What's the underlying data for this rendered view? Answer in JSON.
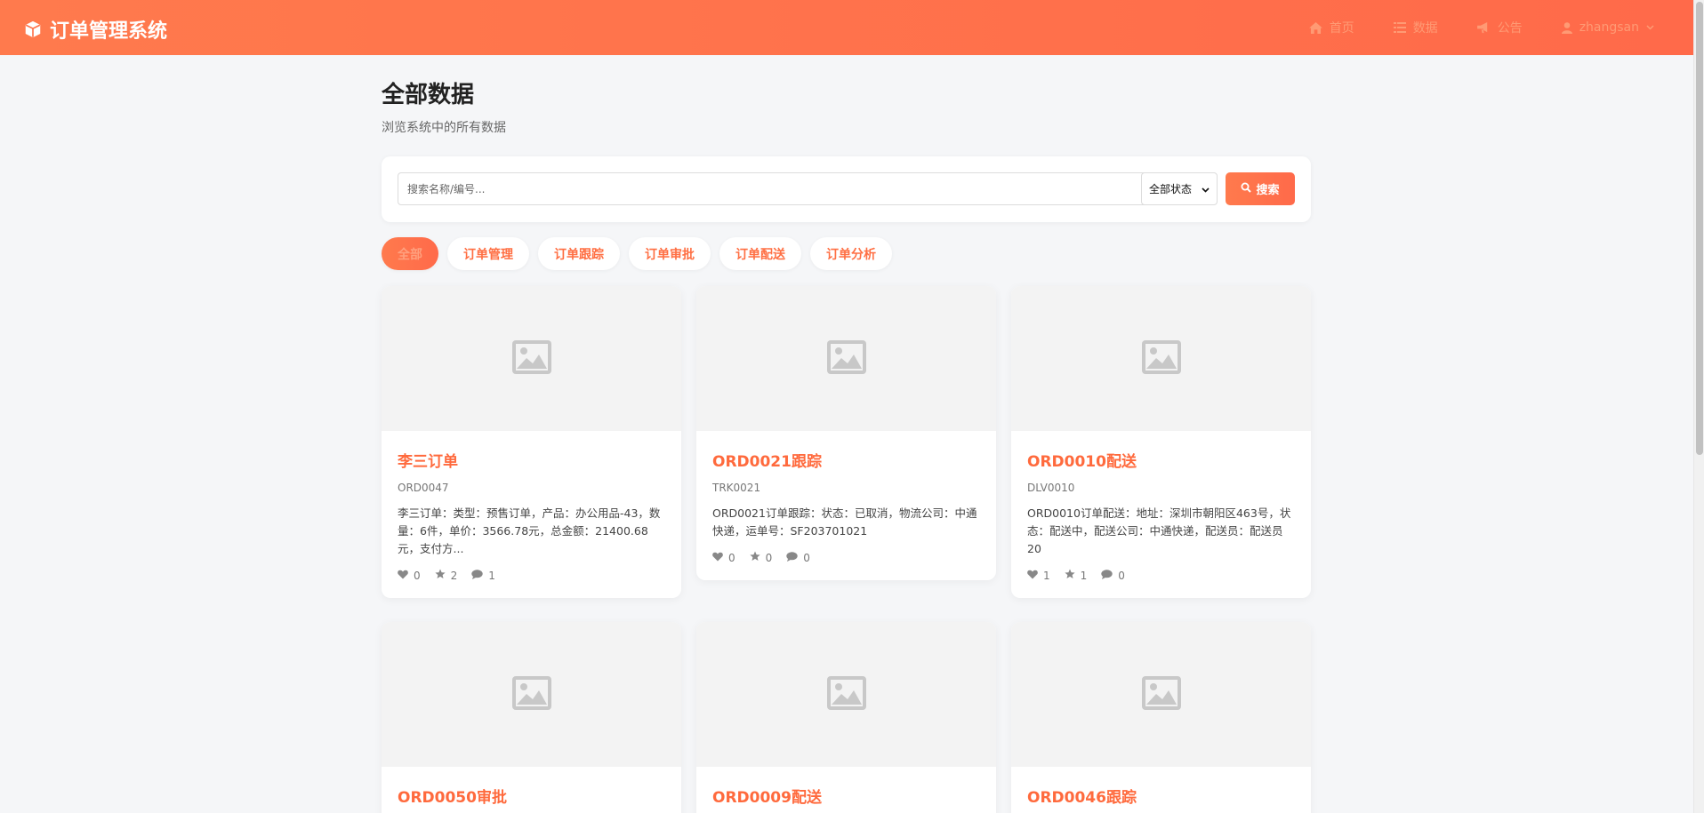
{
  "brand": {
    "title": "订单管理系统",
    "icon": "cube-icon"
  },
  "nav": {
    "items": [
      {
        "label": "首页",
        "icon": "home-icon"
      },
      {
        "label": "数据",
        "icon": "list-icon"
      },
      {
        "label": "公告",
        "icon": "bullhorn-icon"
      },
      {
        "label": "zhangsan",
        "icon": "user-icon"
      }
    ]
  },
  "page": {
    "title": "全部数据",
    "subtitle": "浏览系统中的所有数据"
  },
  "search": {
    "placeholder": "搜索名称/编号...",
    "status_selected": "全部状态",
    "button_label": "搜索"
  },
  "tabs": [
    "全部",
    "订单管理",
    "订单跟踪",
    "订单审批",
    "订单配送",
    "订单分析"
  ],
  "cards": [
    {
      "title": "李三订单",
      "code": "ORD0047",
      "desc": "李三订单：类型：预售订单，产品：办公用品-43，数量：6件，单价：3566.78元，总金额：21400.68元，支付方...",
      "likes": "0",
      "stars": "2",
      "comments": "1"
    },
    {
      "title": "ORD0021跟踪",
      "code": "TRK0021",
      "desc": "ORD0021订单跟踪：状态：已取消，物流公司：中通快递，运单号：SF203701021",
      "likes": "0",
      "stars": "0",
      "comments": "0"
    },
    {
      "title": "ORD0010配送",
      "code": "DLV0010",
      "desc": "ORD0010订单配送：地址：深圳市朝阳区463号，状态：配送中，配送公司：中通快递，配送员：配送员20",
      "likes": "1",
      "stars": "1",
      "comments": "0"
    },
    {
      "title": "ORD0050审批"
    },
    {
      "title": "ORD0009配送"
    },
    {
      "title": "ORD0046跟踪"
    }
  ],
  "colors": {
    "accent": "#ff6f43",
    "accent_gradient_start": "#ff7a4d",
    "accent_gradient_end": "#ff6a4a",
    "background": "#f5f6f8"
  }
}
